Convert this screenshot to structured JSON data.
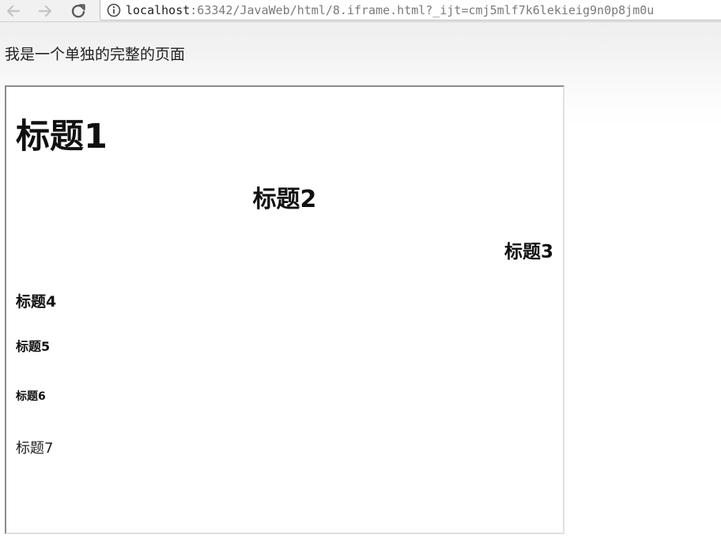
{
  "browser": {
    "url_host": "localhost",
    "url_rest": ":63342/JavaWeb/html/8.iframe.html?_ijt=cmj5mlf7k6lekieig9n0p8jm0u",
    "icons": {
      "back": "arrow-left",
      "forward": "arrow-right",
      "reload": "reload",
      "site_info": "info-circle"
    }
  },
  "page": {
    "text": "我是一个单独的完整的页面"
  },
  "iframe": {
    "headings": {
      "h1": "标题1",
      "h2": "标题2",
      "h3": "标题3",
      "h4": "标题4",
      "h5": "标题5",
      "h6": "标题6",
      "h7": "标题7"
    }
  }
}
